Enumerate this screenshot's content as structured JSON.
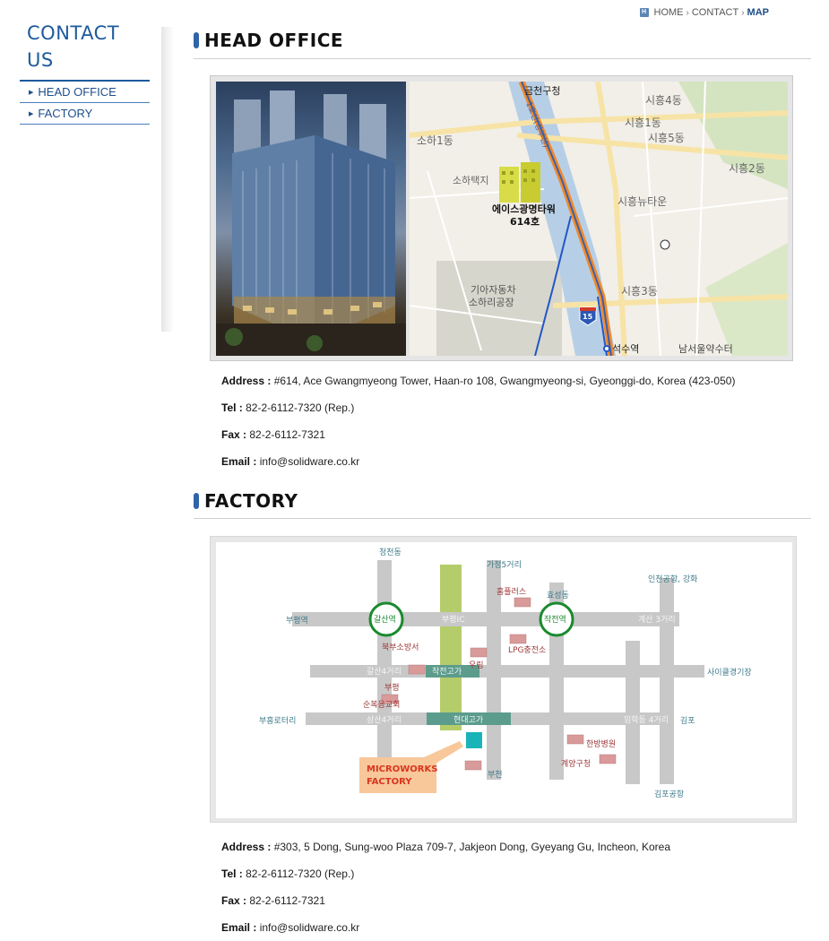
{
  "sidebar": {
    "title": "CONTACT US",
    "items": [
      {
        "label": "HEAD OFFICE"
      },
      {
        "label": "FACTORY"
      }
    ]
  },
  "breadcrumb": {
    "items": [
      "HOME",
      "CONTACT",
      "MAP"
    ],
    "icon_letter": "H"
  },
  "head_office": {
    "title": "HEAD OFFICE",
    "map_labels": {
      "geumcheon_office": "금천구청",
      "siheung4": "시흥4동",
      "siheung1": "시흥1동",
      "siheung5": "시흥5동",
      "siheung2": "시흥2동",
      "soha1": "소하1동",
      "sohataek": "소하택지",
      "siheung_newtown": "시흥뉴타운",
      "tower_name": "에이스광명타워",
      "tower_unit": "614호",
      "kia_factory_1": "기아자동차",
      "kia_factory_2": "소하리공장",
      "siheung3": "시흥3동",
      "route_15": "15",
      "seoksu_station": "석수역",
      "namseoul_pharmacy": "남서울약수터",
      "line_label": "1호선(경부선)"
    },
    "address_label": "Address :",
    "address": "#614, Ace Gwangmyeong Tower, Haan-ro 108, Gwangmyeong-si, Gyeonggi-do, Korea (423-050)",
    "tel_label": "Tel :",
    "tel": "82-2-6112-7320 (Rep.)",
    "fax_label": "Fax :",
    "fax": "82-2-6112-7321",
    "email_label": "Email :",
    "email": "info@solidware.co.kr"
  },
  "factory": {
    "title": "FACTORY",
    "map_labels": {
      "cheongcheon": "청천동",
      "gajeong5": "가정5거리",
      "incheon_airport": "인천공항, 강화",
      "hyoseong": "효성동",
      "hompluss": "홈플러스",
      "bupyeong_st": "부평역",
      "galsan_st": "갈산역",
      "bupyeong_ic": "부평IC",
      "jakjeon_st": "작전역",
      "gyesan3": "계산 3거리",
      "bukbu_fire": "북부소방서",
      "woolim": "우림",
      "lpg": "LPG충전소",
      "galsan4": "갈산4거리",
      "jakjeon_overpass": "작전고가",
      "cycle_track": "사이클경기장",
      "bupyeong_church_1": "부평",
      "bupyeong_church_2": "순복음교회",
      "buheung_rotary": "부흥로터리",
      "samsan4": "삼산4거리",
      "hyundai_overpass": "현대고가",
      "imhak4": "임학동 4거리",
      "gimpo": "김포",
      "hanbang_hospital": "한방병원",
      "gyeyang_office": "계양구청",
      "bucheon": "부천",
      "gimpo_airport": "김포공항",
      "microworks": "MICROWORKS",
      "factory_word": "FACTORY"
    },
    "address_label": "Address :",
    "address": "#303, 5 Dong, Sung-woo Plaza 709-7, Jakjeon Dong, Gyeyang Gu, Incheon, Korea",
    "tel_label": "Tel :",
    "tel": "82-2-6112-7320 (Rep.)",
    "fax_label": "Fax :",
    "fax": "82-2-6112-7321",
    "email_label": "Email :",
    "email": "info@solidware.co.kr"
  },
  "colors": {
    "accent": "#1d5a9c",
    "road_gray": "#c8c8c8",
    "green_road": "#b5cc6a",
    "station_green": "#1a8a2e",
    "building_pink": "#d99a9a",
    "factory_cyan": "#1ab3b8",
    "callout_orange": "#f8c79a",
    "callout_text": "#d8361f"
  }
}
